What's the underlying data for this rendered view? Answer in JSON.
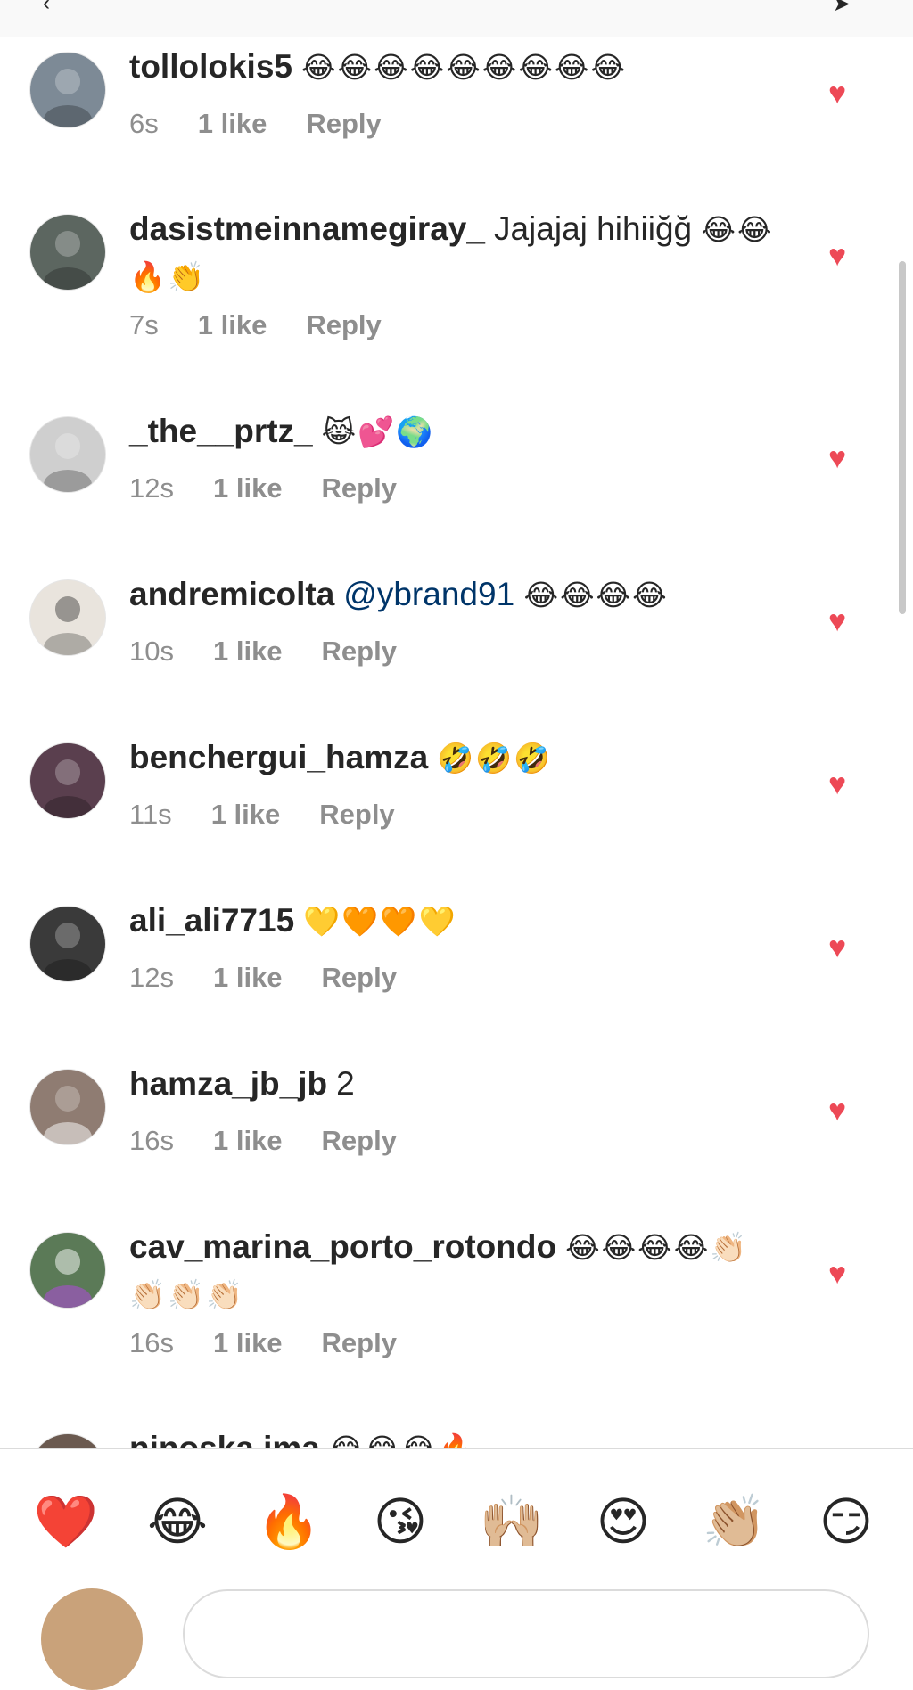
{
  "header": {
    "back_icon": "back-arrow-icon",
    "send_icon": "direct-send-icon"
  },
  "comments": [
    {
      "username": "tollolokis5",
      "text": "",
      "mention": "",
      "emoji": "😂😂😂😂😂😂😂😂😂",
      "time": "6s",
      "likes": "1 like",
      "reply": "Reply",
      "avatar_color": "#7d8a96"
    },
    {
      "username": "dasistmeinnamegiray_",
      "text": "Jajajaj hihiiğğ",
      "mention": "",
      "emoji": "😂😂🔥👏",
      "time": "7s",
      "likes": "1 like",
      "reply": "Reply",
      "avatar_color": "#5c6660"
    },
    {
      "username": "_the__prtz_",
      "text": "",
      "mention": "",
      "emoji": "😹💕🌍",
      "time": "12s",
      "likes": "1 like",
      "reply": "Reply",
      "avatar_color": "#cfcfcf"
    },
    {
      "username": "andremicolta",
      "text": "",
      "mention": "@ybrand91",
      "emoji": "😂😂😂😂",
      "time": "10s",
      "likes": "1 like",
      "reply": "Reply",
      "avatar_color": "#e9e4dd"
    },
    {
      "username": "benchergui_hamza",
      "text": "",
      "mention": "",
      "emoji": "🤣🤣🤣",
      "time": "11s",
      "likes": "1 like",
      "reply": "Reply",
      "avatar_color": "#5a3f4e"
    },
    {
      "username": "ali_ali7715",
      "text": "",
      "mention": "",
      "emoji": "💛🧡🧡💛",
      "time": "12s",
      "likes": "1 like",
      "reply": "Reply",
      "avatar_color": "#3a3a3a"
    },
    {
      "username": "hamza_jb_jb",
      "text": "2",
      "mention": "",
      "emoji": "",
      "time": "16s",
      "likes": "1 like",
      "reply": "Reply",
      "avatar_color": "#8f7c72"
    },
    {
      "username": "cav_marina_porto_rotondo",
      "text": "",
      "mention": "",
      "emoji": "😂😂😂😂👏🏻👏🏻👏🏻👏🏻",
      "time": "16s",
      "likes": "1 like",
      "reply": "Reply",
      "avatar_color": "#5b7a57"
    },
    {
      "username": "ninoska.ima",
      "text": "",
      "mention": "",
      "emoji": "😂😂😂🔥",
      "time": "",
      "likes": "",
      "reply": "",
      "avatar_color": "#6b5a50"
    }
  ],
  "reactions": [
    "❤️",
    "😂",
    "🔥",
    "😘",
    "🙌🏼",
    "😍",
    "👏🏼",
    "😏"
  ],
  "colors": {
    "heart": "#ed4956",
    "meta": "#8e8e8e",
    "mention": "#003569",
    "text": "#262626"
  }
}
